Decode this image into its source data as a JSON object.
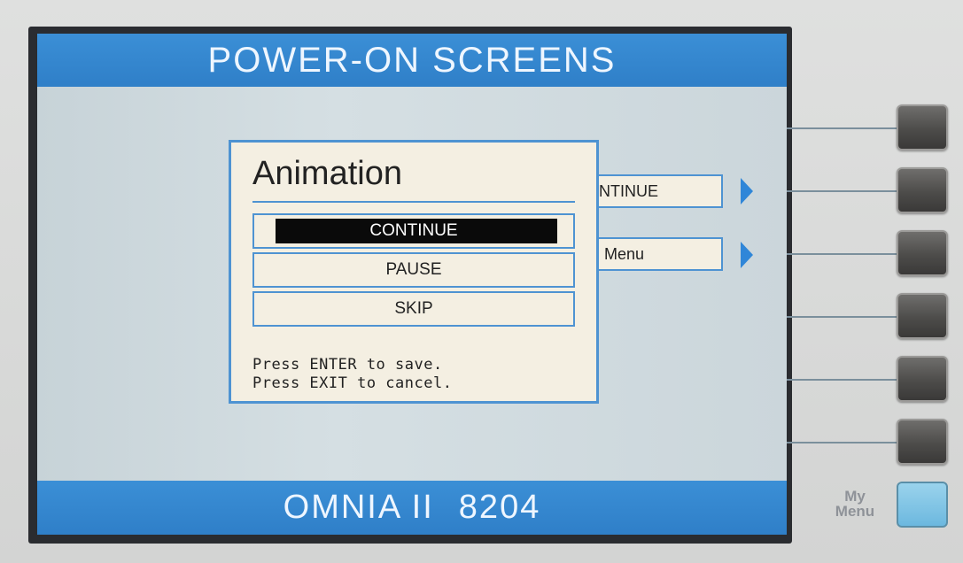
{
  "screen": {
    "title": "POWER-ON SCREENS",
    "footer": {
      "model": "OMNIA II",
      "number": "8204"
    }
  },
  "background_menu": [
    {
      "label": "NTINUE"
    },
    {
      "label": "Menu"
    }
  ],
  "dialog": {
    "title": "Animation",
    "options": [
      {
        "label": "CONTINUE",
        "selected": true
      },
      {
        "label": "PAUSE",
        "selected": false
      },
      {
        "label": "SKIP",
        "selected": false
      }
    ],
    "hints": [
      "Press ENTER to save.",
      "Press EXIT to cancel."
    ]
  },
  "hardware": {
    "softkey_count": 6,
    "my_menu_label": [
      "My",
      "Menu"
    ]
  },
  "colors": {
    "accent_blue": "#2f7fc8",
    "selection": "#0a0a0a",
    "panel": "#f4efe2",
    "my_menu_button": "#7cc3e4"
  }
}
